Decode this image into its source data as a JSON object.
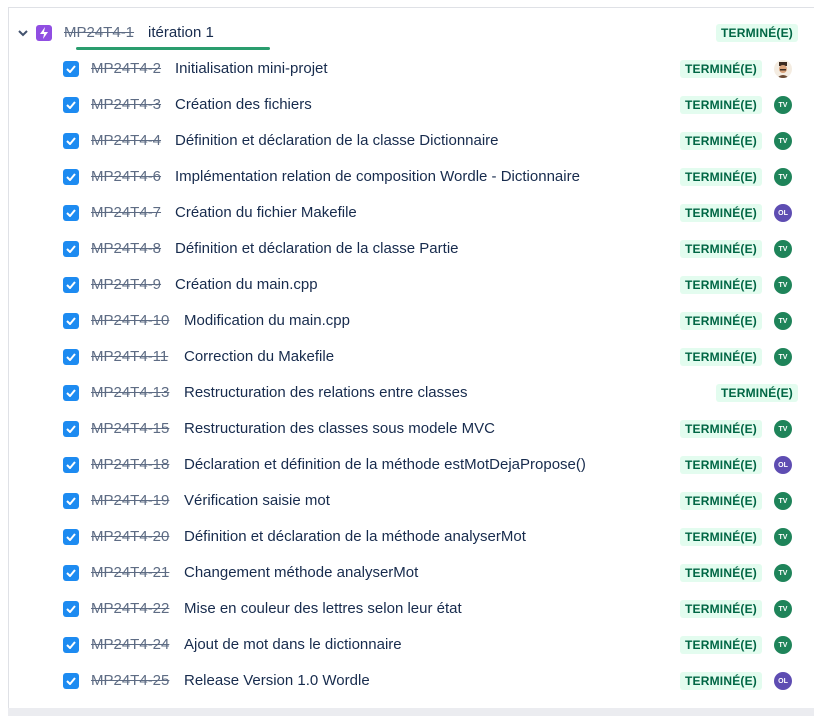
{
  "parent": {
    "key": "MP24T4-1",
    "title": "itération 1",
    "status": "TERMINÉ(E)",
    "icon": "epic-icon",
    "icon_color": "#904ee2"
  },
  "colors": {
    "status_bg": "#e3fcef",
    "status_text": "#006644",
    "checkbox": "#1d8bf1",
    "avatar_TV": "#1f845a",
    "avatar_OL": "#5e4db2",
    "progress_underline": "#2a9d6e"
  },
  "children": [
    {
      "key": "MP24T4-2",
      "title": "Initialisation mini-projet",
      "status": "TERMINÉ(E)",
      "assignee": "photo"
    },
    {
      "key": "MP24T4-3",
      "title": "Création des fichiers",
      "status": "TERMINÉ(E)",
      "assignee": "TV"
    },
    {
      "key": "MP24T4-4",
      "title": "Définition et déclaration de la classe Dictionnaire",
      "status": "TERMINÉ(E)",
      "assignee": "TV"
    },
    {
      "key": "MP24T4-6",
      "title": "Implémentation relation de composition Wordle - Dictionnaire",
      "status": "TERMINÉ(E)",
      "assignee": "TV"
    },
    {
      "key": "MP24T4-7",
      "title": "Création du fichier Makefile",
      "status": "TERMINÉ(E)",
      "assignee": "OL"
    },
    {
      "key": "MP24T4-8",
      "title": "Définition et déclaration de la classe Partie",
      "status": "TERMINÉ(E)",
      "assignee": "TV"
    },
    {
      "key": "MP24T4-9",
      "title": "Création du main.cpp",
      "status": "TERMINÉ(E)",
      "assignee": "TV"
    },
    {
      "key": "MP24T4-10",
      "title": "Modification du main.cpp",
      "status": "TERMINÉ(E)",
      "assignee": "TV"
    },
    {
      "key": "MP24T4-11",
      "title": "Correction du Makefile",
      "status": "TERMINÉ(E)",
      "assignee": "TV"
    },
    {
      "key": "MP24T4-13",
      "title": "Restructuration des relations entre classes",
      "status": "TERMINÉ(E)",
      "assignee": ""
    },
    {
      "key": "MP24T4-15",
      "title": "Restructuration des classes sous modele MVC",
      "status": "TERMINÉ(E)",
      "assignee": "TV"
    },
    {
      "key": "MP24T4-18",
      "title": "Déclaration et définition de la méthode estMotDejaPropose()",
      "status": "TERMINÉ(E)",
      "assignee": "OL"
    },
    {
      "key": "MP24T4-19",
      "title": "Vérification saisie mot",
      "status": "TERMINÉ(E)",
      "assignee": "TV"
    },
    {
      "key": "MP24T4-20",
      "title": "Définition et déclaration de la méthode analyserMot",
      "status": "TERMINÉ(E)",
      "assignee": "TV"
    },
    {
      "key": "MP24T4-21",
      "title": "Changement méthode analyserMot",
      "status": "TERMINÉ(E)",
      "assignee": "TV"
    },
    {
      "key": "MP24T4-22",
      "title": "Mise en couleur des lettres selon leur état",
      "status": "TERMINÉ(E)",
      "assignee": "TV"
    },
    {
      "key": "MP24T4-24",
      "title": "Ajout de mot dans le dictionnaire",
      "status": "TERMINÉ(E)",
      "assignee": "TV"
    },
    {
      "key": "MP24T4-25",
      "title": "Release Version 1.0 Wordle",
      "status": "TERMINÉ(E)",
      "assignee": "OL"
    }
  ]
}
